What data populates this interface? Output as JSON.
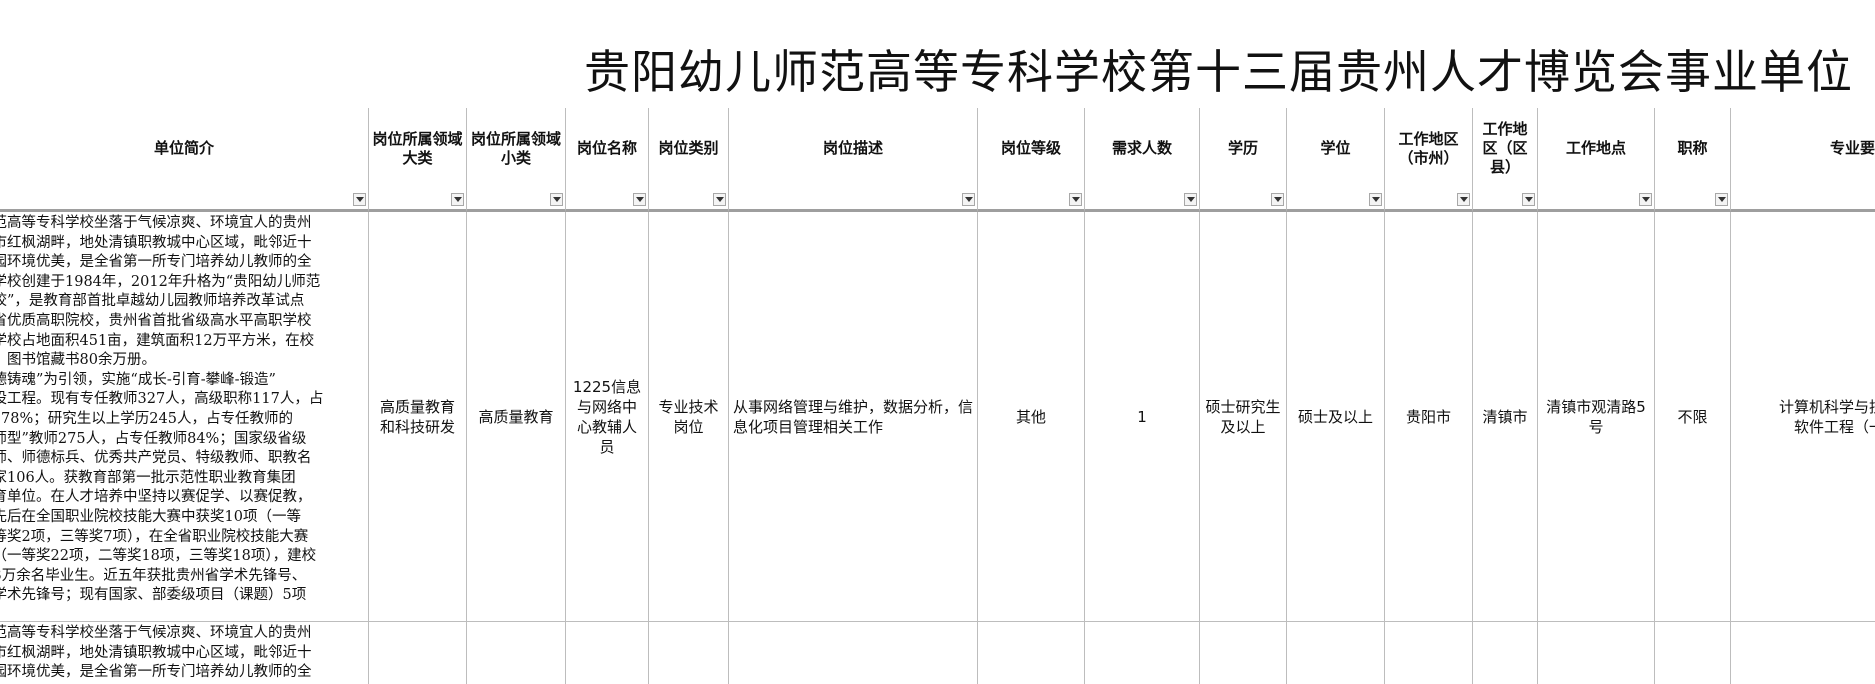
{
  "sheet": {
    "title": "贵阳幼儿师范高等专科学校第十三届贵州人才博览会事业单位",
    "headers": [
      "单位简介",
      "岗位所属领域大类",
      "岗位所属领域小类",
      "岗位名称",
      "岗位类别",
      "岗位描述",
      "岗位等级",
      "需求人数",
      "学历",
      "学位",
      "工作地区（市州）",
      "工作地区（区县）",
      "工作地点",
      "职称",
      "专业要"
    ],
    "row1": {
      "intro": "师范高等专科学校坐落于气候凉爽、环境宜人的贵州\n阳市红枫湖畔，地处清镇职教城中心区域，毗邻近十\n校园环境优美，是全省第一所专门培养幼儿教师的全\n。学校创建于1984年，2012年升格为“贵阳幼儿师范\n学校”，是教育部首批卓越幼儿园教师培养改革试点\n州省优质高职院校，贵州省首批省级高水平高职学校\n。学校占地面积451亩，建筑面积12万平方米，在校\n人，图书馆藏书80余万册。\n师德铸魂”为引领，实施“成长-引育-攀峰-锻造”\n建设工程。现有专任教师327人，高级职称117人，占\n35.78%；研究生以上学历245人，占专任教师的\n双师型”教师275人，占专任教师84%；国家级省级\n教师、师德标兵、优秀共产党员、特级教师、职教名\n专家106人。获教育部第一批示范性职业教育集团\n培育单位。在人才培养中坚持以赛促学、以赛促教，\n生先后在全国职业院校技能大赛中获奖10项（一等\n二等奖2项，三等奖7项），在全省职业院校技能大赛\n项（一等奖22项，二等奖18项，三等奖18项），建校\n了3万余名毕业生。近五年获批贵州省学术先锋号、\n年学术先锋号；现有国家、部委级项目（课题）5项",
      "domain_major": "高质量教育和科技研发",
      "domain_minor": "高质量教育",
      "post_name": "1225信息与网络中心教辅人员",
      "post_category": "专业技术岗位",
      "post_desc": "从事网络管理与维护，数据分析，信息化项目管理相关工作",
      "post_level": "其他",
      "count": "1",
      "education": "硕士研究生及以上",
      "degree": "硕士及以上",
      "city": "贵阳市",
      "district": "清镇市",
      "location": "清镇市观清路5号",
      "title_req": "不限",
      "major": "计算机科学与技术\n软件工程（一"
    },
    "row2": {
      "intro": "师范高等专科学校坐落于气候凉爽、环境宜人的贵州\n阳市红枫湖畔，地处清镇职教城中心区域，毗邻近十\n校园环境优美，是全省第一所专门培养幼儿教师的全"
    }
  }
}
